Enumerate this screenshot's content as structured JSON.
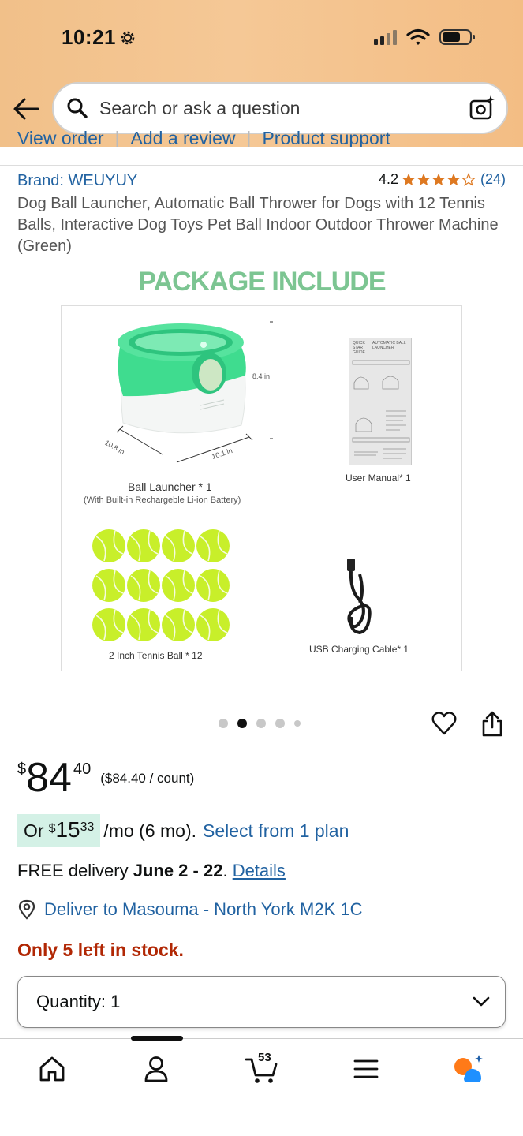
{
  "status_bar": {
    "time": "10:21"
  },
  "search": {
    "placeholder": "Search or ask a question"
  },
  "top_links": [
    "View order",
    "Add a review",
    "Product support"
  ],
  "product": {
    "brand": "Brand: WEUYUY",
    "rating": "4.2",
    "rating_value": 4.2,
    "review_count": "(24)",
    "title": "Dog Ball Launcher, Automatic Ball Thrower for Dogs with 12 Tennis Balls, Interactive Dog Toys Pet Ball Indoor Outdoor Thrower Machine (Green)"
  },
  "image": {
    "heading": "PACKAGE INCLUDE",
    "launcher_label": "Ball Launcher * 1",
    "launcher_sub": "(With Built-in Rechargeble Li-ion Battery)",
    "manual_label": "User Manual* 1",
    "balls_label": "2 Inch Tennis Ball * 12",
    "cable_label": "USB Charging Cable* 1",
    "dim_height": "8.4 in",
    "dim_depth": "10.8 in",
    "dim_width": "10.1 in",
    "manual_heading_1": "QUICK START GUIDE",
    "manual_heading_2": "AUTOMATIC BALL LAUNCHER",
    "carousel_count": 5,
    "carousel_active": 2
  },
  "price": {
    "symbol": "$",
    "whole": "84",
    "fraction": "40",
    "unit_price": "($84.40 / count)"
  },
  "monthly": {
    "prefix": "Or",
    "symbol": "$",
    "whole": "15",
    "fraction": "33",
    "suffix": "/mo (6 mo).",
    "link": "Select from 1 plan"
  },
  "delivery": {
    "prefix": "FREE delivery",
    "dates": "June 2 - 22",
    "period": ".",
    "details": "Details"
  },
  "deliver_to": "Deliver to Masouma - North York M2K 1C",
  "stock": "Only 5 left in stock.",
  "quantity": "Quantity:  1",
  "bottom_nav": {
    "cart_count": "53"
  },
  "colors": {
    "link": "#2162a1",
    "stock": "#b12704",
    "star": "#de7921",
    "header": "#f3c58f",
    "monthly_bg": "#d4f1e6",
    "launcher_green": "#3fdc8f"
  }
}
